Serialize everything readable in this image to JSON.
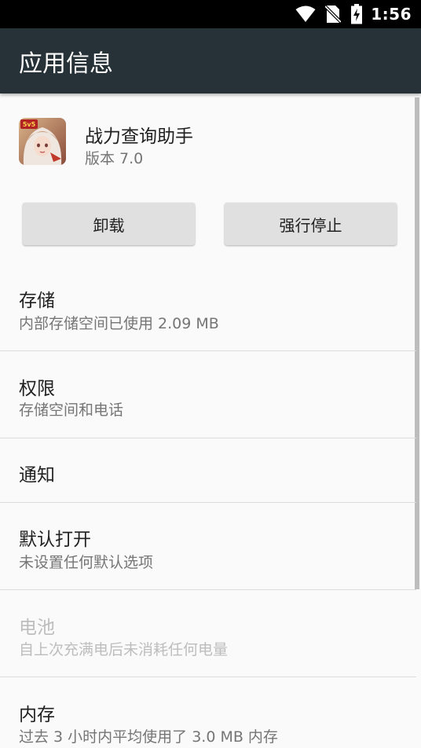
{
  "status_bar": {
    "time": "1:56",
    "icons": [
      "wifi-icon",
      "no-sim-icon",
      "battery-charging-icon"
    ]
  },
  "app_bar": {
    "title": "应用信息",
    "background": "#263238"
  },
  "app": {
    "name": "战力查询助手",
    "version": "版本 7.0",
    "icon": "app-icon",
    "icon_badge": "5v5"
  },
  "buttons": {
    "uninstall": "卸载",
    "force_stop": "强行停止"
  },
  "settings": [
    {
      "title": "存储",
      "summary": "内部存储空间已使用 2.09 MB",
      "enabled": true
    },
    {
      "title": "权限",
      "summary": "存储空间和电话",
      "enabled": true
    },
    {
      "title": "通知",
      "summary": "",
      "enabled": true
    },
    {
      "title": "默认打开",
      "summary": "未设置任何默认选项",
      "enabled": true
    },
    {
      "title": "电池",
      "summary": "自上次充满电后未消耗任何电量",
      "enabled": false
    },
    {
      "title": "内存",
      "summary": "过去 3 小时内平均使用了 3.0 MB 内存",
      "enabled": true
    }
  ]
}
